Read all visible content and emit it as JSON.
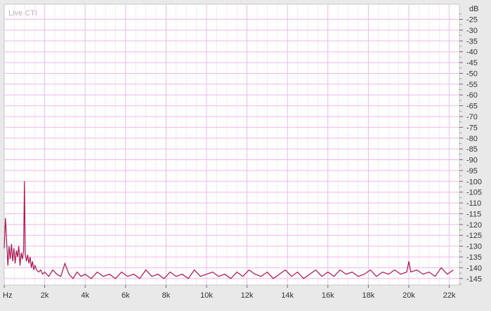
{
  "overlay_label": "Live CTI",
  "colors": {
    "series": "#b0124e",
    "grid": "#f0b8f0",
    "plot_bg": "#ffffff",
    "frame_bg": "#e9e9e9"
  },
  "chart_data": {
    "type": "line",
    "xlim": [
      0,
      22500
    ],
    "ylim": [
      -148,
      -18
    ],
    "x_ticks": [
      0,
      2000,
      4000,
      6000,
      8000,
      10000,
      12000,
      14000,
      16000,
      18000,
      20000,
      22000
    ],
    "x_tick_labels": [
      "Hz",
      "2k",
      "4k",
      "6k",
      "8k",
      "10k",
      "12k",
      "14k",
      "16k",
      "18k",
      "20k",
      "22k"
    ],
    "y_ticks": [
      -25,
      -30,
      -35,
      -40,
      -45,
      -50,
      -55,
      -60,
      -65,
      -70,
      -75,
      -80,
      -85,
      -90,
      -95,
      -100,
      -105,
      -110,
      -115,
      -120,
      -125,
      -130,
      -135,
      -140,
      -145
    ],
    "y_tick_labels": [
      "-25",
      "-30",
      "-35",
      "-40",
      "-45",
      "-50",
      "-55",
      "-60",
      "-65",
      "-70",
      "-75",
      "-80",
      "-85",
      "-90",
      "-95",
      "-100",
      "-105",
      "-110",
      "-115",
      "-120",
      "-125",
      "-130",
      "-135",
      "-140",
      "-145"
    ],
    "y_unit": "dB",
    "grid": true,
    "series": [
      {
        "x": [
          0,
          60,
          120,
          180,
          240,
          300,
          360,
          420,
          480,
          540,
          600,
          660,
          720,
          780,
          840,
          900,
          960,
          1000,
          1040,
          1100,
          1160,
          1220,
          1280,
          1340,
          1400,
          1460,
          1520,
          1600,
          1700,
          1800,
          1900,
          2000,
          2200,
          2400,
          2600,
          2800,
          3000,
          3200,
          3400,
          3600,
          3800,
          4000,
          4300,
          4600,
          4900,
          5200,
          5500,
          5800,
          6100,
          6400,
          6700,
          7000,
          7300,
          7600,
          7900,
          8200,
          8500,
          8800,
          9100,
          9400,
          9700,
          10000,
          10300,
          10600,
          10900,
          11200,
          11500,
          11800,
          12100,
          12400,
          12700,
          13000,
          13300,
          13600,
          13900,
          14200,
          14500,
          14800,
          15100,
          15400,
          15700,
          16000,
          16300,
          16600,
          16900,
          17200,
          17500,
          17800,
          18100,
          18400,
          18700,
          19000,
          19300,
          19600,
          19900,
          20000,
          20100,
          20400,
          20700,
          21000,
          21300,
          21600,
          21900,
          22200
        ],
        "y": [
          -131,
          -117,
          -128,
          -139,
          -130,
          -136,
          -129,
          -137,
          -131,
          -138,
          -132,
          -135,
          -130,
          -139,
          -133,
          -136,
          -132,
          -100,
          -134,
          -137,
          -134,
          -138,
          -135,
          -140,
          -137,
          -141,
          -139,
          -141,
          -142,
          -141,
          -143,
          -142,
          -144,
          -141,
          -143,
          -144,
          -138,
          -143,
          -145,
          -142,
          -144,
          -143,
          -145,
          -142,
          -144,
          -143,
          -145,
          -142,
          -144,
          -143,
          -145,
          -141,
          -144,
          -143,
          -145,
          -142,
          -144,
          -143,
          -145,
          -141,
          -144,
          -143,
          -142,
          -144,
          -143,
          -145,
          -142,
          -144,
          -141,
          -143,
          -144,
          -142,
          -145,
          -143,
          -141,
          -144,
          -142,
          -145,
          -143,
          -141,
          -144,
          -142,
          -144,
          -141,
          -143,
          -142,
          -144,
          -143,
          -141,
          -144,
          -142,
          -143,
          -141,
          -143,
          -142,
          -137,
          -142,
          -141,
          -143,
          -142,
          -144,
          -140,
          -143,
          -141
        ]
      }
    ]
  }
}
